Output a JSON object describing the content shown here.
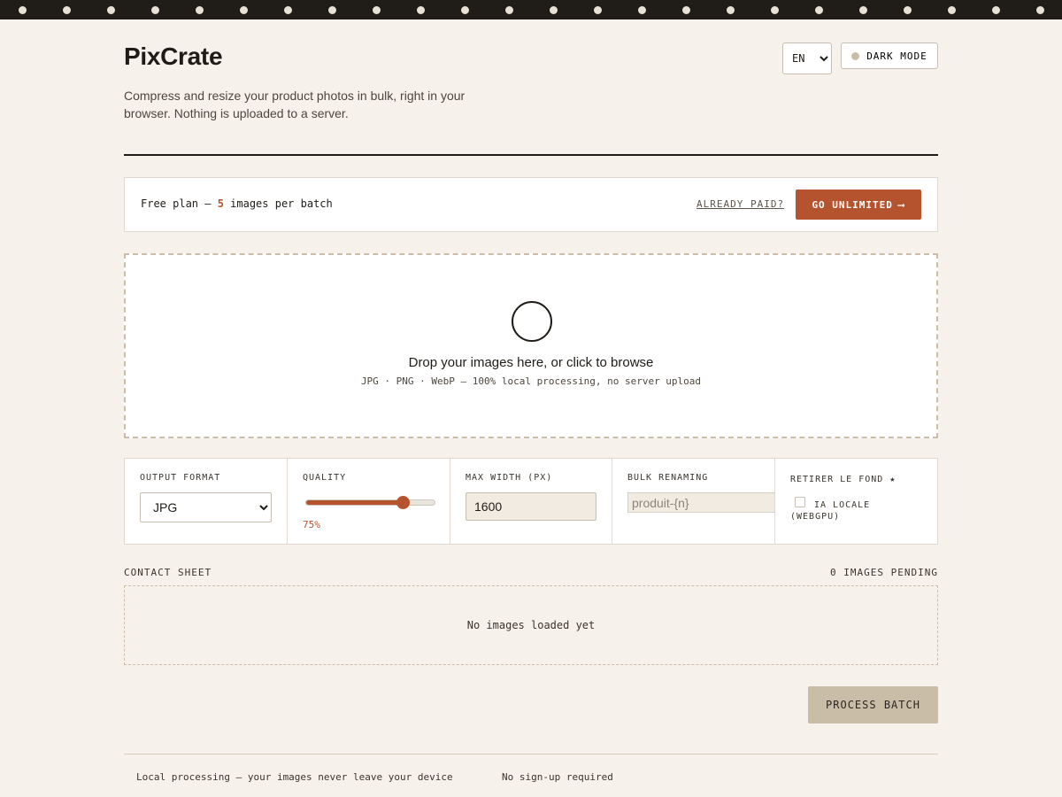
{
  "app": {
    "title": "PixCrate",
    "tagline": "Compress and resize your product photos in bulk, right in your browser. Nothing is uploaded to a server."
  },
  "header": {
    "language": {
      "selected": "EN",
      "options": [
        "EN"
      ]
    },
    "dark_mode_label": "DARK MODE"
  },
  "plan": {
    "text_prefix": "Free plan — ",
    "limit": "5",
    "text_suffix": " images per batch",
    "already_paid_label": "ALREADY PAID?",
    "unlimited_label": "GO UNLIMITED",
    "unlimited_arrow": "⟶"
  },
  "dropzone": {
    "title": "Drop your images here, or click to browse",
    "subtitle": "JPG · PNG · WebP — 100% local processing, no server upload"
  },
  "settings": {
    "format": {
      "label": "OUTPUT FORMAT",
      "selected": "JPG",
      "options": [
        "JPG"
      ]
    },
    "quality": {
      "label": "QUALITY",
      "value": 75,
      "display": "75%"
    },
    "max_width": {
      "label": "MAX WIDTH (PX)",
      "value": "1600"
    },
    "renaming": {
      "label": "BULK RENAMING",
      "placeholder": "produit-{n}"
    },
    "background": {
      "label": "RETIRER LE FOND ★",
      "checkbox_label": "IA LOCALE (WEBGPU)",
      "checked": false
    }
  },
  "contact_sheet": {
    "label": "CONTACT SHEET",
    "count_label": "0 IMAGES PENDING",
    "empty_text": "No images loaded yet"
  },
  "actions": {
    "process_label": "PROCESS BATCH"
  },
  "footer": {
    "privacy": "Local processing — your images never leave your device",
    "signup": "No sign-up required"
  },
  "colors": {
    "accent": "#b5532e",
    "background": "#f6f1ea",
    "dark": "#201c17"
  }
}
